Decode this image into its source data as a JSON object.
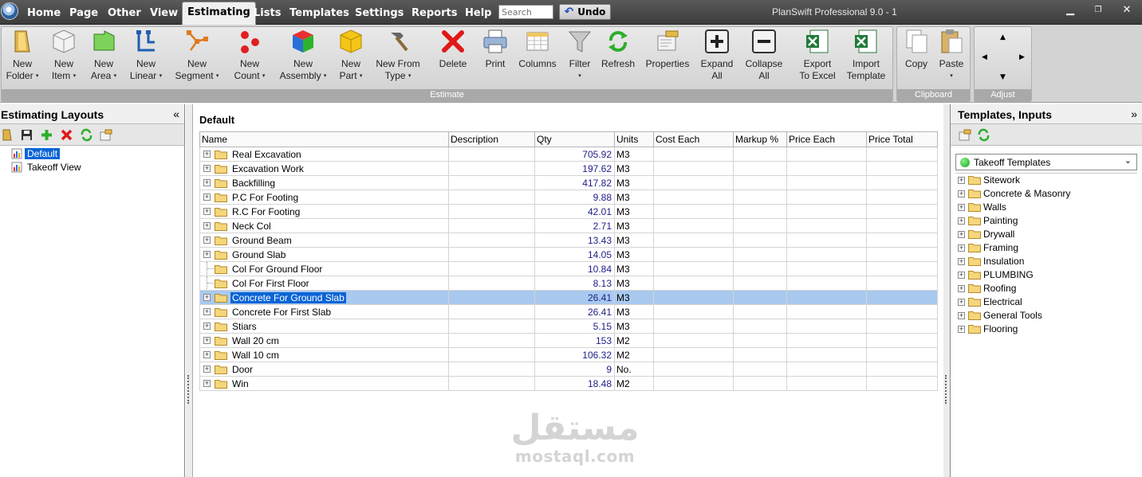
{
  "menu": {
    "items": [
      "Home",
      "Page",
      "Other",
      "View",
      "Estimating",
      "Lists",
      "Templates",
      "Settings",
      "Reports",
      "Help"
    ],
    "active": "Estimating",
    "search_placeholder": "Search",
    "undo_label": "Undo",
    "app_title": "PlanSwift Professional 9.0 - 1"
  },
  "ribbon": {
    "estimate_group_label": "Estimate",
    "clipboard_group_label": "Clipboard",
    "adjust_group_label": "Adjust",
    "buttons": {
      "new_folder": [
        "New",
        "Folder"
      ],
      "new_item": [
        "New",
        "Item"
      ],
      "new_area": [
        "New",
        "Area"
      ],
      "new_linear": [
        "New",
        "Linear"
      ],
      "new_segment": [
        "New",
        "Segment"
      ],
      "new_count": [
        "New",
        "Count"
      ],
      "new_assembly": [
        "New",
        "Assembly"
      ],
      "new_part": [
        "New",
        "Part"
      ],
      "new_from_type": [
        "New From",
        "Type"
      ],
      "delete": [
        "Delete",
        ""
      ],
      "print": [
        "Print",
        ""
      ],
      "columns": [
        "Columns",
        ""
      ],
      "filter": [
        "Filter",
        ""
      ],
      "refresh": [
        "Refresh",
        ""
      ],
      "properties": [
        "Properties",
        ""
      ],
      "expand_all": [
        "Expand",
        "All"
      ],
      "collapse_all": [
        "Collapse",
        "All"
      ],
      "export_excel": [
        "Export",
        "To Excel"
      ],
      "import_template": [
        "Import",
        "Template"
      ],
      "copy": [
        "Copy",
        ""
      ],
      "paste": [
        "Paste",
        ""
      ]
    },
    "caret": "▾"
  },
  "left_panel": {
    "title": "Estimating Layouts",
    "collapse_glyph": "«",
    "layouts": [
      "Default",
      "Takeoff View"
    ],
    "selected": "Default"
  },
  "main": {
    "layout_title": "Default",
    "columns": [
      "Name",
      "Description",
      "Qty",
      "Units",
      "Cost Each",
      "Markup %",
      "Price Each",
      "Price Total"
    ],
    "rows": [
      {
        "name": "Real Excavation",
        "qty": "705.92",
        "units": "M3",
        "expandable": true
      },
      {
        "name": "Excavation Work",
        "qty": "197.62",
        "units": "M3",
        "expandable": true
      },
      {
        "name": "Backfilling",
        "qty": "417.82",
        "units": "M3",
        "expandable": true
      },
      {
        "name": "P.C For Footing",
        "qty": "9.88",
        "units": "M3",
        "expandable": true
      },
      {
        "name": "R.C For Footing",
        "qty": "42.01",
        "units": "M3",
        "expandable": true
      },
      {
        "name": "Neck Col",
        "qty": "2.71",
        "units": "M3",
        "expandable": true
      },
      {
        "name": "Ground Beam",
        "qty": "13.43",
        "units": "M3",
        "expandable": true
      },
      {
        "name": "Ground Slab",
        "qty": "14.05",
        "units": "M3",
        "expandable": true
      },
      {
        "name": "Col For Ground Floor",
        "qty": "10.84",
        "units": "M3",
        "expandable": false
      },
      {
        "name": "Col For First Floor",
        "qty": "8.13",
        "units": "M3",
        "expandable": false
      },
      {
        "name": "Concrete For Ground Slab",
        "qty": "26.41",
        "units": "M3",
        "expandable": true,
        "selected": true
      },
      {
        "name": "Concrete For First Slab",
        "qty": "26.41",
        "units": "M3",
        "expandable": true
      },
      {
        "name": "Stiars",
        "qty": "5.15",
        "units": "M3",
        "expandable": true
      },
      {
        "name": "Wall 20 cm",
        "qty": "153",
        "units": "M2",
        "expandable": true
      },
      {
        "name": "Wall 10 cm",
        "qty": "106.32",
        "units": "M2",
        "expandable": true
      },
      {
        "name": "Door",
        "qty": "9",
        "units": "No.",
        "expandable": true
      },
      {
        "name": "Win",
        "qty": "18.48",
        "units": "M2",
        "expandable": true
      }
    ],
    "watermark_ar": "مستقل",
    "watermark_en": "mostaql.com"
  },
  "right_panel": {
    "title": "Templates, Inputs",
    "collapse_glyph": "»",
    "selected_template": "Takeoff Templates",
    "folders": [
      "Sitework",
      "Concrete & Masonry",
      "Walls",
      "Painting",
      "Drywall",
      "Framing",
      "Insulation",
      "PLUMBING",
      "Roofing",
      "Electrical",
      "General Tools",
      "Flooring"
    ]
  },
  "colors": {
    "selection": "#0a64d6",
    "selected_row": "#a9c9ef",
    "qty_text": "#20208a",
    "menubar": "#3c3c3c"
  }
}
